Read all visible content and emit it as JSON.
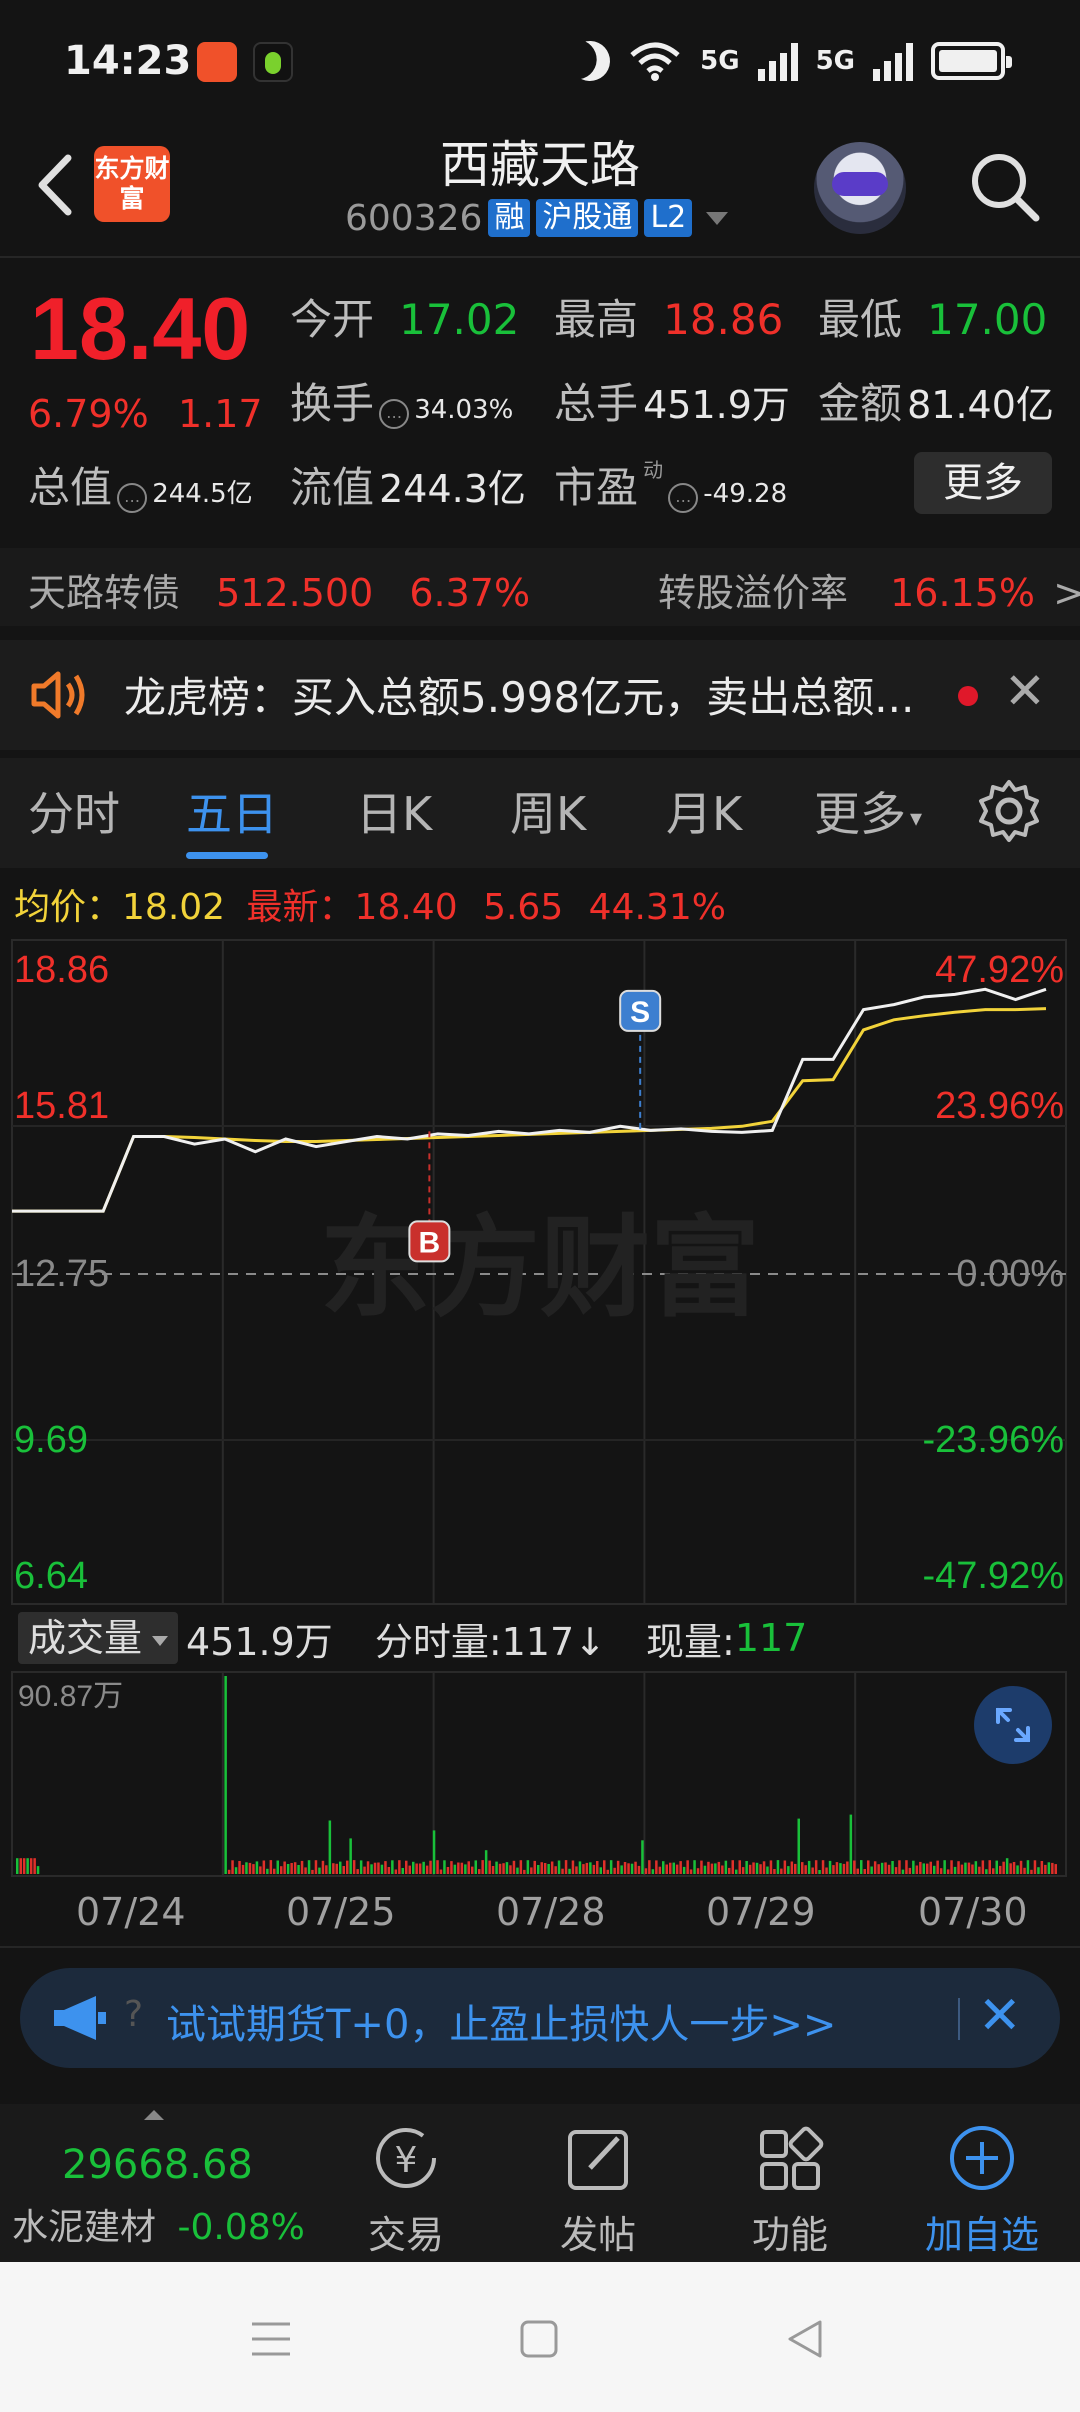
{
  "status_bar": {
    "time": "14:23",
    "network_labels": [
      "5G",
      "5G"
    ]
  },
  "header": {
    "logo_text": "东方财富",
    "title": "西藏天路",
    "stock_code": "600326",
    "tags": [
      "融",
      "沪股通",
      "L2"
    ]
  },
  "quote": {
    "price": "18.40",
    "change_pct": "6.79%",
    "change_amt": "1.17",
    "open_label": "今开",
    "open": "17.02",
    "high_label": "最高",
    "high": "18.86",
    "low_label": "最低",
    "low": "17.00",
    "turnover_label": "换手",
    "turnover": "34.03%",
    "volume_label": "总手",
    "volume": "451.9万",
    "amount_label": "金额",
    "amount": "81.40亿",
    "mktcap_label": "总值",
    "mktcap": "244.5亿",
    "float_label": "流值",
    "float_cap": "244.3亿",
    "pe_label": "市盈",
    "pe_sup": "动",
    "pe": "-49.28",
    "more_button": "更多"
  },
  "bond": {
    "name": "天路转债",
    "price": "512.500",
    "pct": "6.37%",
    "premium_label": "转股溢价率",
    "premium": "16.15%",
    "arrow": ">"
  },
  "dragon_tiger": {
    "text": "龙虎榜：买入总额5.998亿元，卖出总额..."
  },
  "tabs": [
    {
      "label": "分时"
    },
    {
      "label": "五日"
    },
    {
      "label": "日K"
    },
    {
      "label": "周K"
    },
    {
      "label": "月K"
    },
    {
      "label": "更多"
    }
  ],
  "legend": {
    "avg_label": "均价：",
    "avg": "18.02",
    "latest_label": "最新：",
    "latest": "18.40",
    "chg": "5.65",
    "pct": "44.31%"
  },
  "chart_data": {
    "type": "line",
    "watermark": "东方财富",
    "y_left_labels": [
      "18.86",
      "15.81",
      "12.75",
      "9.69",
      "6.64"
    ],
    "y_right_labels": [
      "47.92%",
      "23.96%",
      "0.00%",
      "-23.96%",
      "-47.92%"
    ],
    "ylim": [
      6.64,
      18.86
    ],
    "prev_close": 12.75,
    "days": [
      "07/24",
      "07/25",
      "07/28",
      "07/29",
      "07/30"
    ],
    "series": [
      {
        "values": [
          14.03,
          14.03,
          14.03,
          14.03,
          15.5,
          15.5,
          15.35,
          15.45,
          15.2,
          15.45,
          15.3,
          15.4,
          15.5,
          15.45,
          15.55,
          15.52,
          15.6,
          15.55,
          15.62,
          15.58,
          15.7,
          15.62,
          15.65,
          15.6,
          15.58,
          15.62,
          17.02,
          17.02,
          18.0,
          18.1,
          18.25,
          18.3,
          18.4,
          18.2,
          18.4
        ]
      },
      {
        "values": [
          14.03,
          14.03,
          14.03,
          14.03,
          15.5,
          15.5,
          15.48,
          15.45,
          15.42,
          15.4,
          15.4,
          15.42,
          15.44,
          15.46,
          15.48,
          15.5,
          15.52,
          15.54,
          15.56,
          15.58,
          15.6,
          15.62,
          15.64,
          15.66,
          15.7,
          15.8,
          16.6,
          16.62,
          17.6,
          17.8,
          17.88,
          17.95,
          18.0,
          18.0,
          18.02
        ]
      }
    ],
    "markers": [
      {
        "label": "S",
        "day_index": 2,
        "price": 15.65
      },
      {
        "label": "B",
        "day_index": 1,
        "price": 15.6
      }
    ],
    "volume": {
      "selector": "成交量",
      "total": "451.9万",
      "tick_label": "分时量:117↓",
      "current_label": "现量:",
      "current": "117",
      "max_label": "90.87万"
    }
  },
  "promo": {
    "text": "试试期货T+0，止盈止损快人一步>>",
    "q": "?"
  },
  "bottom": {
    "index_value": "29668.68",
    "index_name": "水泥建材",
    "index_pct": "-0.08%",
    "tabs": [
      {
        "label": "交易"
      },
      {
        "label": "发帖"
      },
      {
        "label": "功能"
      },
      {
        "label": "加自选"
      }
    ]
  },
  "colors": {
    "up": "#f0302a",
    "down": "#19c03a",
    "accent": "#3d92ee",
    "avg_line": "#f2d33a"
  }
}
